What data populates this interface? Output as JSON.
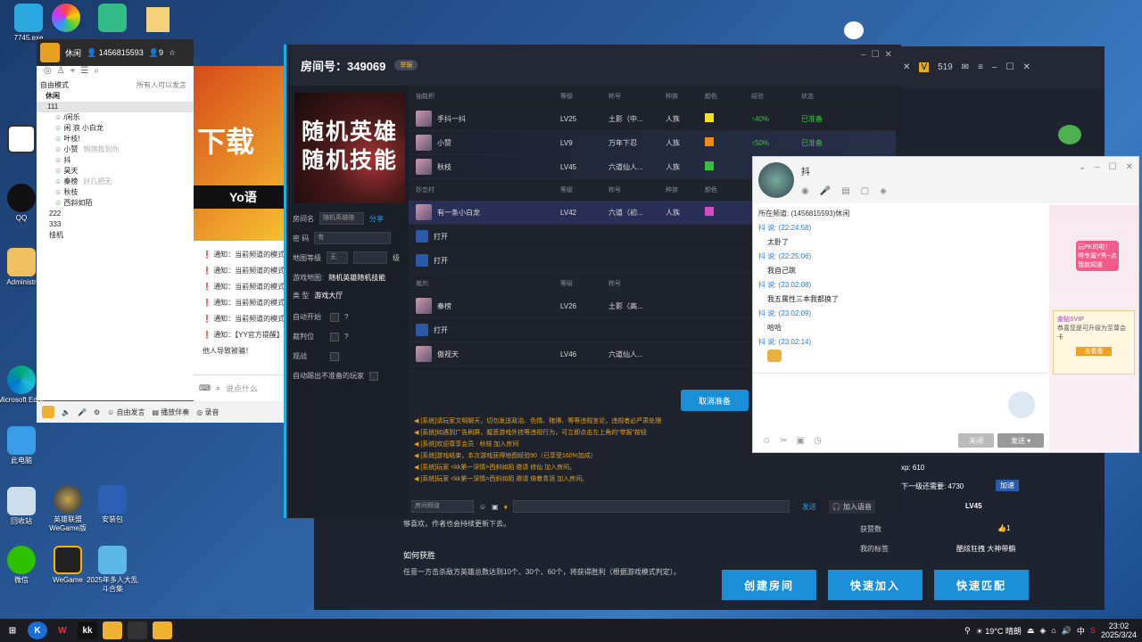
{
  "desktop": {
    "icons": [
      {
        "label": "7745.exe"
      },
      {
        "label": "Microsoft Edge"
      },
      {
        "label": "此电脑"
      },
      {
        "label": "回收站"
      },
      {
        "label": "微信"
      },
      {
        "label": "QQ"
      },
      {
        "label": "Administr"
      },
      {
        "label": "英雄联盟 WeGame版"
      },
      {
        "label": "WeGame"
      },
      {
        "label": "安装包"
      },
      {
        "label": "2025年多人大乱斗合集"
      }
    ]
  },
  "yy": {
    "status": "休闲",
    "user_id": "1456815593",
    "count": "9",
    "mode": "自由模式",
    "all_label": "所有人可以发言",
    "channel_root": "休闲",
    "channel_111": "111",
    "members": [
      "/闲乐",
      "闲 浪 小白龙",
      "叶枝!",
      "小赞",
      "抖",
      "昊天",
      "秦榜",
      "秋枝",
      "西斜如陌"
    ],
    "member_notes": [
      "",
      "",
      "",
      "悄悄我到你",
      "",
      "",
      "好几把无",
      "",
      ""
    ],
    "sub_channels": [
      "222",
      "333",
      "挂机"
    ],
    "notices": [
      "通知：当前频道的模式",
      "通知：当前频道的模式",
      "通知：当前频道的模式",
      "通知：当前频道的模式",
      "通知：当前频道的模式",
      "通知：【YY官方提醒】..."
    ],
    "notice_tail": "他人导致被骗！",
    "input_placeholder": "说点什么",
    "toolbar": [
      "自由发言",
      "播放伴奏",
      "录音"
    ],
    "banner_text": "下载",
    "banner_sub": "Yo语"
  },
  "room": {
    "title": "房间号：349069",
    "tag": "举报",
    "cover_line1": "随机英雄",
    "cover_line2": "随机技能",
    "settings": {
      "room_name_label": "房间名",
      "room_name_value": "随机英雄随",
      "share": "分享",
      "password_label": "密 码",
      "password_value": "有",
      "map_level_label": "地图等级",
      "map_level_value": "无",
      "level_suffix": "级",
      "game_map_label": "游戏地图:",
      "game_map_value": "随机英雄随机技能",
      "type_label": "类 型",
      "type_value": "游戏大厅",
      "auto_start": "自动开始",
      "referee_seat": "裁判位",
      "spectate": "观战",
      "auto_kick": "自动踢出不准备的玩家"
    },
    "columns": [
      "抽能积",
      "等级",
      "称号",
      "种族",
      "颜色",
      "经验",
      "状态"
    ],
    "team1": [
      {
        "name": "手抖一抖",
        "lv": "LV25",
        "title": "土影（中...",
        "race": "人族",
        "color": "#f5e21a",
        "exp": "↑40%",
        "state": "已准备"
      },
      {
        "name": "小赞",
        "lv": "LV9",
        "title": "万年下忍",
        "race": "人族",
        "color": "#f28a1a",
        "exp": "↑50%",
        "state": "已准备"
      },
      {
        "name": "秋枝",
        "lv": "LV45",
        "title": "六道仙人...",
        "race": "人族",
        "color": "#36c236",
        "exp": "",
        "state": ""
      }
    ],
    "team2_header": "妙恋村",
    "team2": [
      {
        "name": "有一条小白龙",
        "lv": "LV42",
        "title": "六道（初...",
        "race": "人族",
        "color": "#d64bc4",
        "exp": "",
        "state": ""
      },
      {
        "name": "打开",
        "lv": "",
        "title": "",
        "race": "",
        "color": "",
        "exp": "",
        "state": ""
      },
      {
        "name": "打开",
        "lv": "",
        "title": "",
        "race": "",
        "color": "",
        "exp": "",
        "state": ""
      }
    ],
    "referee_header": "裁判",
    "referees": [
      {
        "name": "秦榜",
        "lv": "LV26",
        "title": "土影（高..."
      },
      {
        "name": "打开",
        "lv": "",
        "title": ""
      },
      {
        "name": "傲视天",
        "lv": "LV46",
        "title": "六道仙人..."
      }
    ],
    "cancel_button": "取消准备",
    "system_lines": [
      "[系统]请玩家文明聊天，切勿发送政治、色情、赌博、等等违规言论，违规者必严肃处理",
      "[系统]如遇到广告刷屏，腥恶游戏外挂等违规行为，可立即点击左上角的“举报”按钮",
      "[系统]欢迎尊享会员 · 秋枝 加入房间",
      "[系统]游戏结束，本次游戏获得地图经验90（已享受160%加成）",
      "[系统]玩家 <kk第一深情>西斜如陌 邀请 修仙 加入房间。",
      "[系统]玩家 <kk第一深情>西斜如陌 邀请 倚着青涯 加入房间。"
    ],
    "channel_select": "房间频道",
    "send": "发送",
    "join_voice": "加入语音"
  },
  "chat": {
    "name": "抖",
    "channel_info": "所在频道: (1456815593)休闲",
    "messages": [
      {
        "time": "抖 说: (22:24:58)",
        "text": "太卧了"
      },
      {
        "time": "抖 说: (22:25:06)",
        "text": "我自己跳"
      },
      {
        "time": "抖 说: (23:02:08)",
        "text": "我五属性三本我都换了"
      },
      {
        "time": "抖 说: (23:02:09)",
        "text": "哈哈"
      },
      {
        "time": "抖 说: (23:02:14)",
        "text": ""
      }
    ],
    "close": "关闭",
    "send": "发送",
    "ad_text": "玩PK的啦！得专属Y秀~点我就知道",
    "vip_text": "金钻SVIP",
    "vip_desc": "恭喜您是可升级为至尊会卡",
    "vip_btn": "去看看"
  },
  "profile": {
    "exp": "xp: 610",
    "next": "下一级还需要: 4730",
    "add": "加速",
    "level": "LV45",
    "likes_label": "获赞数",
    "likes": "1",
    "tags_label": "我的标签",
    "tags_value": "酷炫狂拽 大神带躺"
  },
  "lobby": {
    "line1": "够喜欢，作者也会持续更新下去。",
    "how_title": "如何获胜",
    "how_text": "任意一方击杀敌方英雄总数达到10个、30个、60个，将获得胜利（根据游戏模式判定）。",
    "buttons": [
      "创建房间",
      "快速加入",
      "快速匹配"
    ]
  },
  "tray": {
    "temp": "19°C 晴朗",
    "lang": "中",
    "time": "23:02",
    "date": "2025/3/24"
  }
}
